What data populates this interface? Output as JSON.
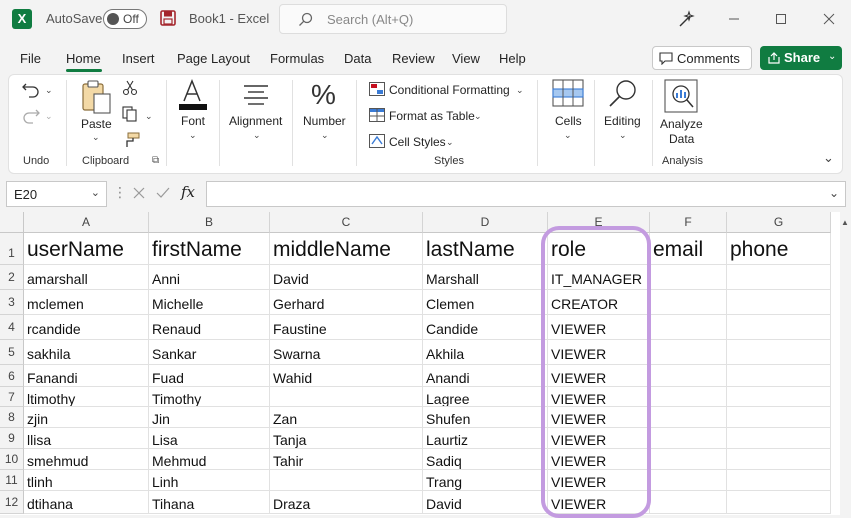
{
  "titlebar": {
    "autosave_label": "AutoSave",
    "toggle_state": "Off",
    "doc_title": "Book1  -  Excel",
    "search_placeholder": "Search (Alt+Q)"
  },
  "menu": {
    "tabs": [
      "File",
      "Home",
      "Insert",
      "Page Layout",
      "Formulas",
      "Data",
      "Review",
      "View",
      "Help"
    ],
    "active": "Home",
    "comments_label": "Comments",
    "share_label": "Share"
  },
  "ribbon": {
    "undo_group": "Undo",
    "paste_label": "Paste",
    "clipboard_group": "Clipboard",
    "font_label": "Font",
    "alignment_label": "Alignment",
    "number_label": "Number",
    "conditional_formatting": "Conditional Formatting",
    "format_as_table": "Format as Table",
    "cell_styles": "Cell Styles",
    "styles_group": "Styles",
    "cells_label": "Cells",
    "editing_label": "Editing",
    "analyze_data_line1": "Analyze",
    "analyze_data_line2": "Data",
    "analysis_group": "Analysis"
  },
  "formula_bar": {
    "name_box": "E20",
    "fx": "fx",
    "formula": ""
  },
  "sheet": {
    "columns": [
      "A",
      "B",
      "C",
      "D",
      "E",
      "F",
      "G"
    ],
    "rows": [
      [
        "userName",
        "firstName",
        "middleName",
        "lastName",
        "role",
        "email",
        "phone"
      ],
      [
        "amarshall",
        "Anni",
        "David",
        "Marshall",
        "IT_MANAGER",
        "",
        ""
      ],
      [
        "mclemen",
        "Michelle",
        "Gerhard",
        "Clemen",
        "CREATOR",
        "",
        ""
      ],
      [
        "rcandide",
        "Renaud",
        "Faustine",
        "Candide",
        "VIEWER",
        "",
        ""
      ],
      [
        "sakhila",
        "Sankar",
        "Swarna",
        "Akhila",
        "VIEWER",
        "",
        ""
      ],
      [
        "Fanandi",
        "Fuad",
        "Wahid",
        "Anandi",
        "VIEWER",
        "",
        ""
      ],
      [
        "ltimothy",
        "Timothy",
        "",
        "Lagree",
        "VIEWER",
        "",
        ""
      ],
      [
        "zjin",
        "Jin",
        "Zan",
        "Shufen",
        "VIEWER",
        "",
        ""
      ],
      [
        "llisa",
        "Lisa",
        "Tanja",
        "Laurtiz",
        "VIEWER",
        "",
        ""
      ],
      [
        "smehmud",
        "Mehmud",
        "Tahir",
        "Sadiq",
        "VIEWER",
        "",
        ""
      ],
      [
        "tlinh",
        "Linh",
        "",
        "Trang",
        "VIEWER",
        "",
        ""
      ],
      [
        "dtihana",
        "Tihana",
        "Draza",
        "David",
        "VIEWER",
        "",
        ""
      ]
    ],
    "row_numbers": [
      "1",
      "2",
      "3",
      "4",
      "5",
      "6",
      "7",
      "8",
      "9",
      "10",
      "11",
      "12"
    ]
  },
  "colors": {
    "excel_green": "#107c41",
    "highlight_purple": "#c39be0"
  }
}
